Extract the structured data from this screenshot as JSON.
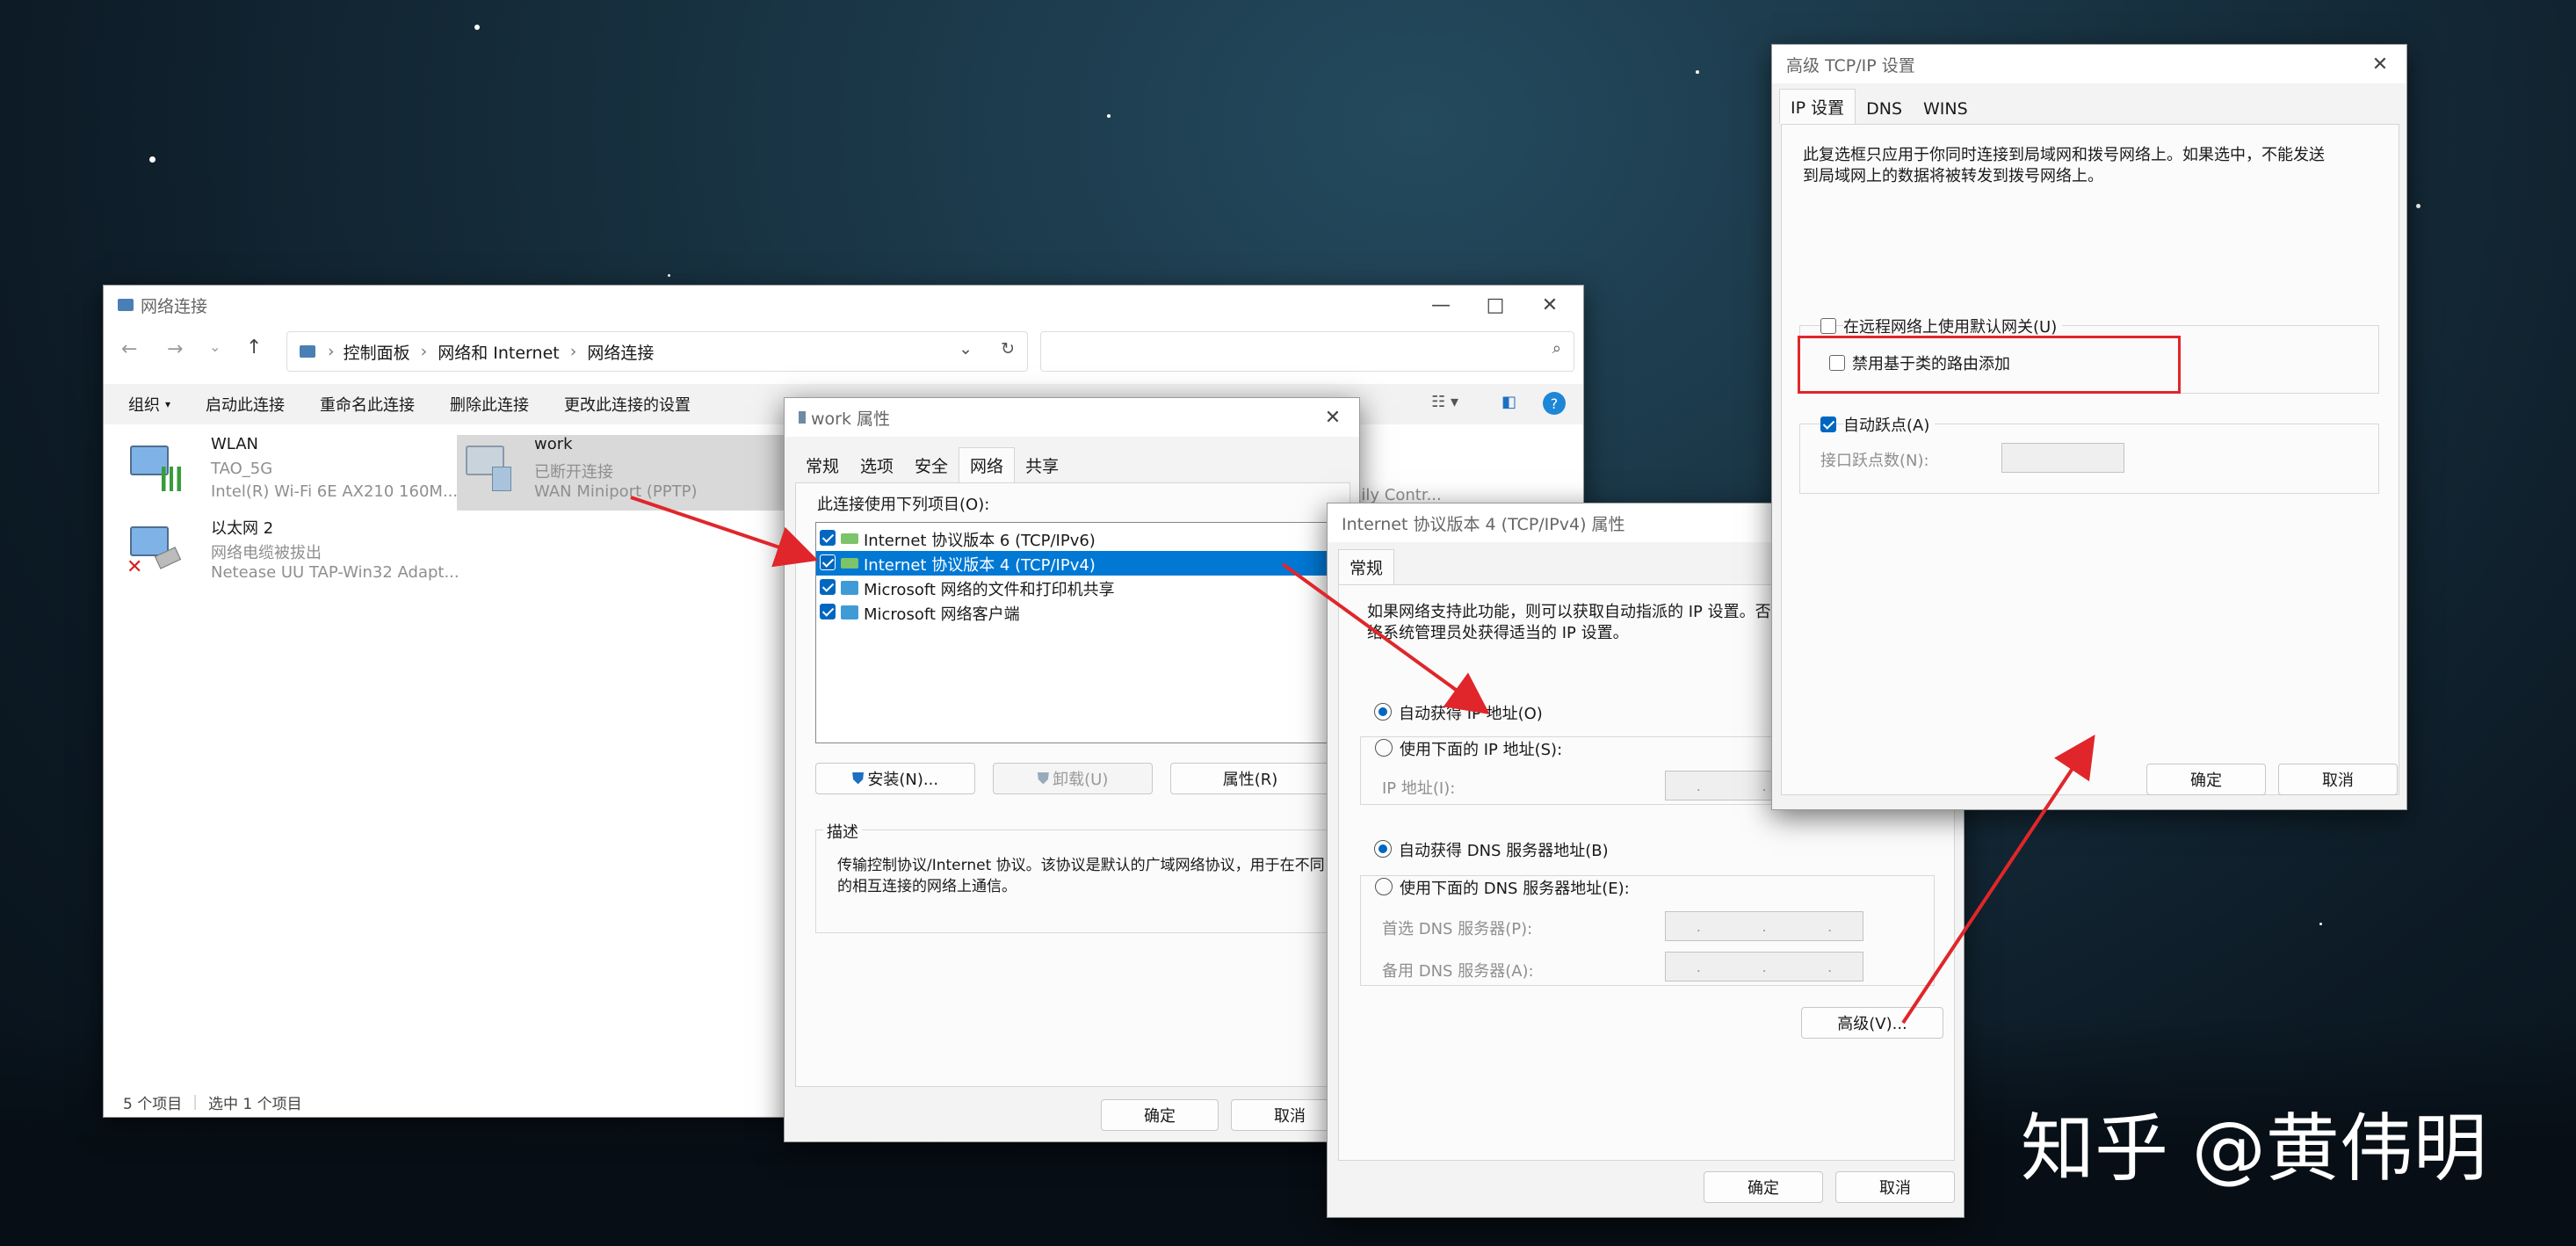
{
  "net_window": {
    "title": "网络连接",
    "breadcrumb": [
      "控制面板",
      "网络和 Internet",
      "网络连接"
    ],
    "toolbar": [
      "组织",
      "启动此连接",
      "重命名此连接",
      "删除此连接",
      "更改此连接的设置"
    ],
    "items": [
      {
        "name": "WLAN",
        "line1": "TAO_5G",
        "line2": "Intel(R) Wi-Fi 6E AX210 160M..."
      },
      {
        "name": "work",
        "line1": "已断开连接",
        "line2": "WAN Miniport (PPTP)"
      },
      {
        "name": "以太网 2",
        "line1": "网络电缆被拔出",
        "line2": "Netease UU TAP-Win32 Adapt..."
      }
    ],
    "partial_item": "nily Contr...",
    "status": {
      "count": "5 个项目",
      "selected": "选中 1 个项目"
    }
  },
  "work_props": {
    "title": "work 属性",
    "tabs": [
      "常规",
      "选项",
      "安全",
      "网络",
      "共享"
    ],
    "list_label": "此连接使用下列项目(O):",
    "components": [
      {
        "label": "Internet 协议版本 6 (TCP/IPv6)"
      },
      {
        "label": "Internet 协议版本 4 (TCP/IPv4)"
      },
      {
        "label": "Microsoft 网络的文件和打印机共享"
      },
      {
        "label": "Microsoft 网络客户端"
      }
    ],
    "buttons": {
      "install": "安装(N)...",
      "uninstall": "卸载(U)",
      "properties": "属性(R)"
    },
    "desc_label": "描述",
    "desc_text": "传输控制协议/Internet 协议。该协议是默认的广域网络协议，用于在不同的相互连接的网络上通信。",
    "ok": "确定",
    "cancel": "取消"
  },
  "ipv4_props": {
    "title": "Internet 协议版本 4 (TCP/IPv4) 属性",
    "tab": "常规",
    "intro_l1": "如果网络支持此功能，则可以获取自动指派的 IP 设置。否则",
    "intro_l2": "络系统管理员处获得适当的 IP 设置。",
    "auto_ip": "自动获得 IP 地址(O)",
    "manual_ip": "使用下面的 IP 地址(S):",
    "ip_label": "IP 地址(I):",
    "auto_dns": "自动获得 DNS 服务器地址(B)",
    "manual_dns": "使用下面的 DNS 服务器地址(E):",
    "pref_dns": "首选 DNS 服务器(P):",
    "alt_dns": "备用 DNS 服务器(A):",
    "dots": ".",
    "advanced": "高级(V)...",
    "ok": "确定",
    "cancel": "取消"
  },
  "adv_tcpip": {
    "title": "高级 TCP/IP 设置",
    "tabs": [
      "IP 设置",
      "DNS",
      "WINS"
    ],
    "desc_l1": "此复选框只应用于你同时连接到局域网和拨号网络上。如果选中，不能发送",
    "desc_l2": "到局域网上的数据将被转发到拨号网络上。",
    "cb_default_gw": "在远程网络上使用默认网关(U)",
    "cb_class_route": "禁用基于类的路由添加",
    "cb_auto_metric": "自动跃点(A)",
    "metric_label": "接口跃点数(N):",
    "ok": "确定",
    "cancel": "取消"
  },
  "watermark": "知乎 @黄伟明",
  "colors": {
    "accent": "#0067c0",
    "highlight_box": "#e0262a",
    "arrow": "#e0262a"
  }
}
